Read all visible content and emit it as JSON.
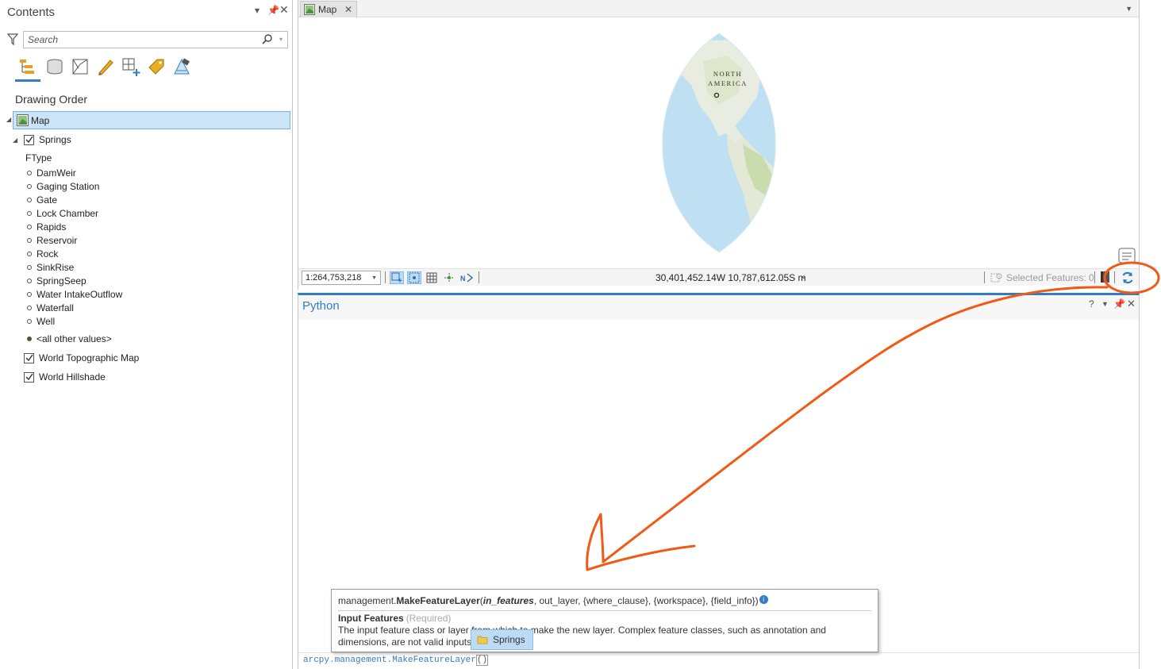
{
  "contents": {
    "title": "Contents",
    "search_placeholder": "Search",
    "drawing_order": "Drawing Order",
    "map_node": "Map",
    "layer_springs": "Springs",
    "ftype_heading": "FType",
    "legend_items": [
      "DamWeir",
      "Gaging Station",
      "Gate",
      "Lock Chamber",
      "Rapids",
      "Reservoir",
      "Rock",
      "SinkRise",
      "SpringSeep",
      "Water IntakeOutflow",
      "Waterfall",
      "Well"
    ],
    "other_values": "<all other values>",
    "layer_topo": "World Topographic Map",
    "layer_hillshade": "World Hillshade"
  },
  "map_view": {
    "tab_label": "Map",
    "continent_label_1": "NORTH",
    "continent_label_2": "AMERICA",
    "scale": "1:264,753,218",
    "coordinates": "30,401,452.14W 10,787,612.05S m",
    "selected_features": "Selected Features: 0"
  },
  "python": {
    "title": "Python",
    "help": "?",
    "input_code": "arcpy.management.MakeFeatureLayer",
    "input_parens": "()",
    "tooltip": {
      "func_prefix": "management.",
      "func_name": "MakeFeatureLayer",
      "open_paren": "(",
      "current_arg": "in_features",
      "other_args": ", out_layer, {where_clause}, {workspace}, {field_info})",
      "info_glyph": "i",
      "param_name": "Input Features",
      "param_required": "(Required)",
      "param_desc": "The input feature class or layer from which to make the new layer. Complex feature classes, such as annotation and dimensions, are not valid inputs to this tool."
    },
    "completion_item": "Springs"
  },
  "colors": {
    "accent": "#2f7dc6",
    "annotation": "#f05a14",
    "selection": "#cce4f7"
  },
  "icons": [
    "filter-icon",
    "search-icon",
    "list-by-drawing-order-icon",
    "list-by-source-icon",
    "list-by-editing-icon",
    "list-by-selection-icon",
    "list-by-snapping-icon",
    "list-by-labeling-icon",
    "list-by-perspective-icon",
    "refresh-icon",
    "pause-icon"
  ]
}
